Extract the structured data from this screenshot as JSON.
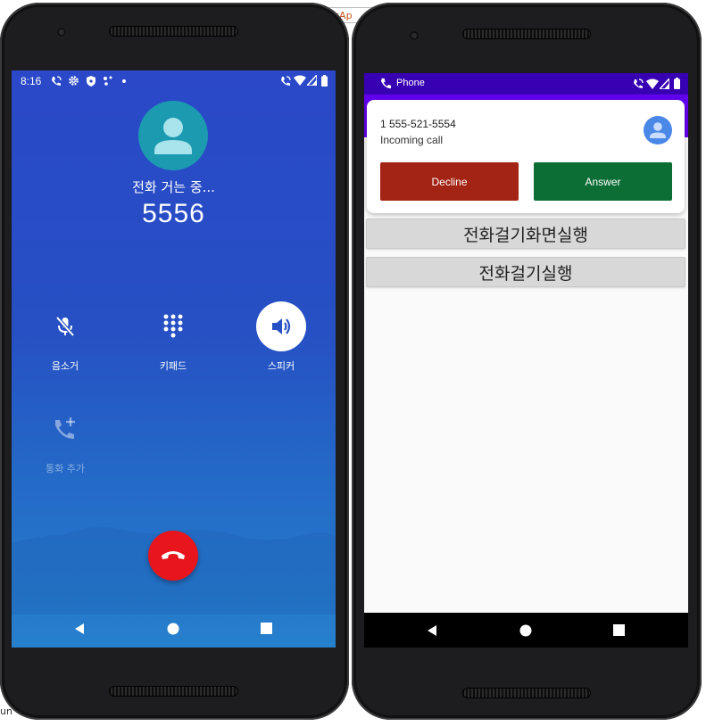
{
  "background": {
    "tab_text": "cAp",
    "run_text": "un"
  },
  "left_phone": {
    "status_bar": {
      "time": "8:16",
      "left_icons": [
        "wifi-call-icon",
        "gear-icon",
        "shield-icon",
        "dots-icon",
        "dot-icon"
      ],
      "right_icons": [
        "wifi-call-icon",
        "wifi-icon",
        "signal-icon",
        "battery-icon"
      ]
    },
    "call": {
      "status": "전화 거는 중...",
      "number": "5556"
    },
    "controls": [
      {
        "label": "음소거",
        "icon": "mic-off-icon",
        "active": false
      },
      {
        "label": "키패드",
        "icon": "dialpad-icon",
        "active": false
      },
      {
        "label": "스피커",
        "icon": "speaker-icon",
        "active": true
      },
      {
        "label": "통화 추가",
        "icon": "add-call-icon",
        "active": false,
        "disabled": true
      }
    ],
    "end_call_icon": "end-call-icon",
    "colors": {
      "accent_end": "#e8151d",
      "avatar": "#1c9ab0"
    }
  },
  "right_phone": {
    "status_bar": {
      "app_name": "Phone",
      "right_icons": [
        "wifi-call-icon",
        "wifi-icon",
        "signal-icon",
        "battery-icon"
      ]
    },
    "notification": {
      "caller_number": "1 555-521-5554",
      "subtitle": "Incoming call",
      "decline_label": "Decline",
      "answer_label": "Answer"
    },
    "buttons": [
      {
        "label": "전화걸기화면실행"
      },
      {
        "label": "전화걸기실행"
      }
    ],
    "colors": {
      "appbar": "#6200ee",
      "statusbar": "#3700b3",
      "decline": "#a32414",
      "answer": "#0c6e34"
    }
  }
}
